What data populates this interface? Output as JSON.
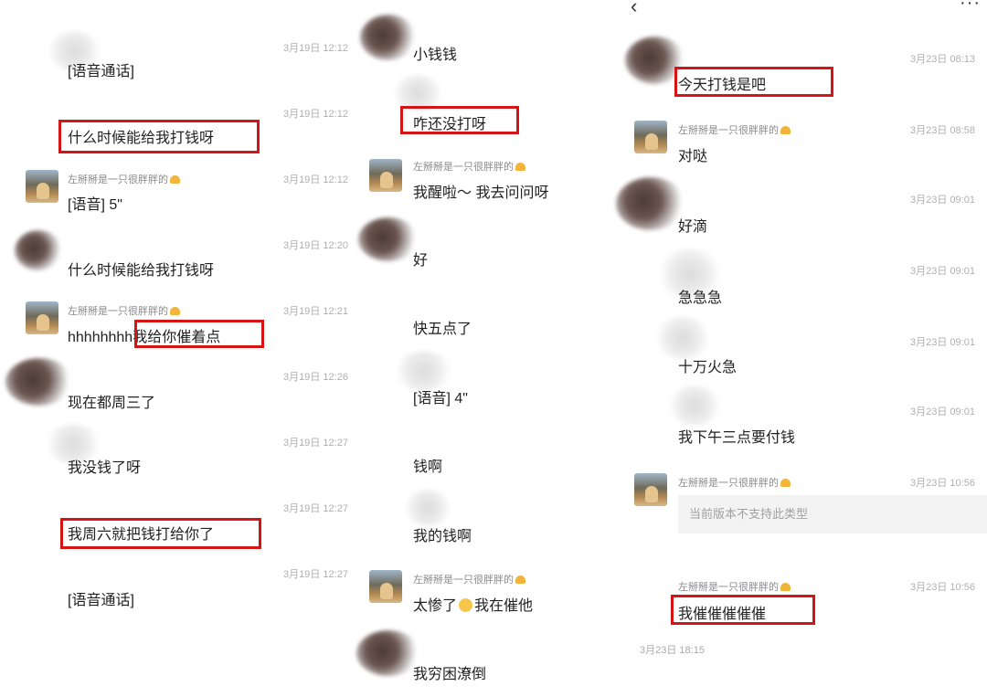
{
  "col1": {
    "messages": [
      {
        "sender": "",
        "time": "3月19日 12:12",
        "text": "[语音通话]"
      },
      {
        "sender": "",
        "time": "3月19日 12:12",
        "text": "什么时候能给我打钱呀"
      },
      {
        "sender": "左掰掰是一只很胖胖的",
        "time": "3月19日 12:12",
        "text": "[语音] 5\""
      },
      {
        "sender": "",
        "time": "3月19日 12:20",
        "text": "什么时候能给我打钱呀"
      },
      {
        "sender": "左掰掰是一只很胖胖的",
        "time": "3月19日 12:21",
        "text": "hhhhhhhh我给你催着点"
      },
      {
        "sender": "",
        "time": "3月19日 12:26",
        "text": "现在都周三了"
      },
      {
        "sender": "",
        "time": "3月19日 12:27",
        "text": "我没钱了呀"
      },
      {
        "sender": "",
        "time": "3月19日 12:27",
        "text": "我周六就把钱打给你了"
      },
      {
        "sender": "",
        "time": "3月19日 12:27",
        "text": "[语音通话]"
      }
    ]
  },
  "col2": {
    "messages": [
      {
        "sender": "",
        "text": "小钱钱"
      },
      {
        "sender": "",
        "text": "咋还没打呀"
      },
      {
        "sender": "左掰掰是一只很胖胖的",
        "text": "我醒啦～ 我去问问呀"
      },
      {
        "sender": "",
        "text": "好"
      },
      {
        "sender": "",
        "text": "快五点了"
      },
      {
        "sender": "",
        "text": "[语音] 4\""
      },
      {
        "sender": "",
        "text": "钱啊"
      },
      {
        "sender": "",
        "text": "我的钱啊"
      },
      {
        "sender": "左掰掰是一只很胖胖的",
        "text_before": "太惨了",
        "text_after": "我在催他"
      },
      {
        "sender": "",
        "text": "我穷困潦倒"
      }
    ]
  },
  "col3": {
    "back_icon": "‹",
    "more_icon": "···",
    "messages": [
      {
        "sender": "",
        "time": "3月23日 08:13",
        "text": "今天打钱是吧"
      },
      {
        "sender": "左掰掰是一只很胖胖的",
        "time": "3月23日 08:58",
        "text": "对哒"
      },
      {
        "sender": "",
        "time": "3月23日 09:01",
        "text": "好滴"
      },
      {
        "sender": "",
        "time": "3月23日 09:01",
        "text": "急急急"
      },
      {
        "sender": "",
        "time": "3月23日 09:01",
        "text": "十万火急"
      },
      {
        "sender": "",
        "time": "3月23日 09:01",
        "text": "我下午三点要付钱"
      },
      {
        "sender": "左掰掰是一只很胖胖的",
        "time": "3月23日 10:56",
        "text": "当前版本不支持此类型"
      },
      {
        "sender": "左掰掰是一只很胖胖的",
        "time": "3月23日 10:56",
        "text": "我催催催催催"
      }
    ],
    "date_stamp": "3月23日 18:15"
  },
  "colors": {
    "highlight": "#d51515",
    "time": "#b0b0b0",
    "sender": "#8a8a8a"
  }
}
